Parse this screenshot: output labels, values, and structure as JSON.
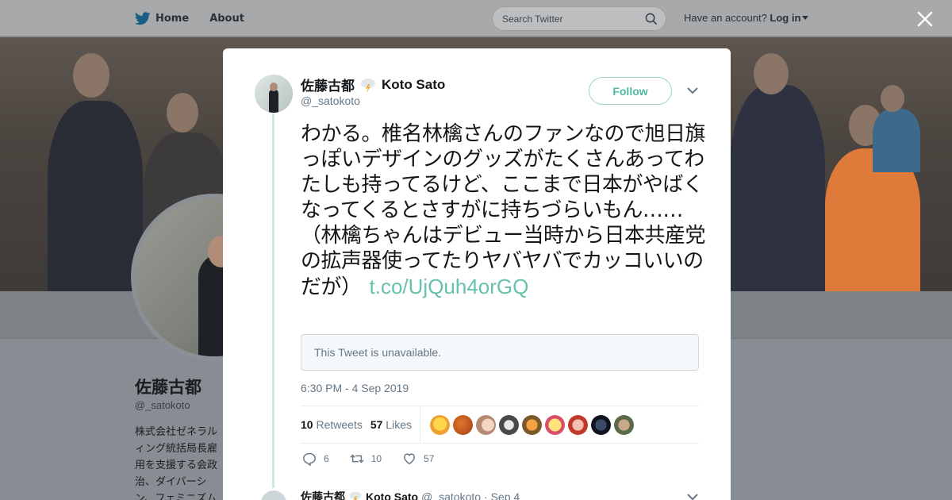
{
  "nav": {
    "home_label": "Home",
    "about_label": "About",
    "search_placeholder": "Search Twitter",
    "account_prompt": "Have an account?",
    "login_label": "Log in"
  },
  "profile": {
    "name": "佐藤古都",
    "handle": "@_satokoto",
    "bio": "株式会社ゼネラルィング統括局長雇用を支援する会政治、ダイバーシン、フェミニズム"
  },
  "tweet": {
    "author_name": "佐藤古都",
    "author_name_latin": "Koto Sato",
    "author_handle": "@_satokoto",
    "follow_label": "Follow",
    "text": "わかる。椎名林檎さんのファンなので旭日旗っぽいデザインのグッズがたくさんあってわたしも持ってるけど、ここまで日本がやばくなってくるとさすがに持ちづらいもん……（林檎ちゃんはデビュー当時から日本共産党の拡声器使ってたりヤバヤバでカッコいいのだが）",
    "link": "t.co/UjQuh4orGQ",
    "quoted_unavailable": "This Tweet is unavailable.",
    "timestamp": "6:30 PM - 4 Sep 2019",
    "retweets_count": "10",
    "retweets_label": "Retweets",
    "likes_count": "57",
    "likes_label": "Likes",
    "reply_count": "6",
    "retweet_action_count": "10",
    "like_action_count": "57"
  },
  "reply": {
    "name": "佐藤古都",
    "name_latin": "Koto Sato",
    "handle": "@_satokoto",
    "date": "· Sep 4"
  },
  "colors": {
    "accent": "#66c2ad",
    "follow_border": "#99d6c8",
    "thread_line": "#c9e9e2",
    "muted": "#657786"
  }
}
